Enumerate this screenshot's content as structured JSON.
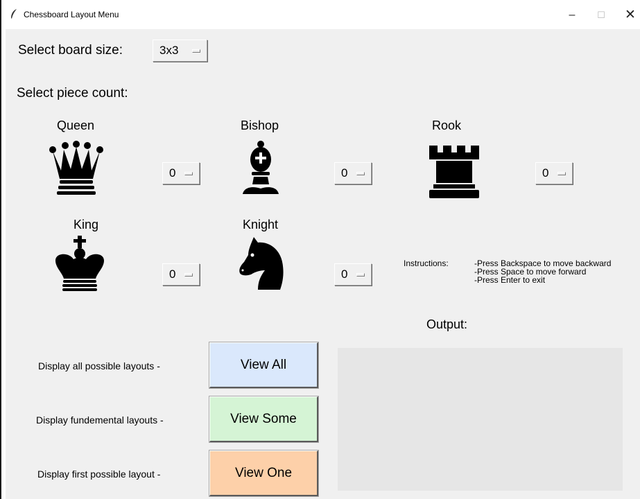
{
  "window": {
    "title": "Chessboard Layout Menu",
    "minimize_glyph": "–",
    "maximize_glyph": "☐",
    "close_glyph": "✕"
  },
  "board_size": {
    "label": "Select board size:",
    "value": "3x3"
  },
  "piece_count_label": "Select piece count:",
  "pieces": [
    {
      "name": "Queen",
      "icon": "queen-icon",
      "count": "0"
    },
    {
      "name": "Bishop",
      "icon": "bishop-icon",
      "count": "0"
    },
    {
      "name": "Rook",
      "icon": "rook-icon",
      "count": "0"
    },
    {
      "name": "King",
      "icon": "king-icon",
      "count": "0"
    },
    {
      "name": "Knight",
      "icon": "knight-icon",
      "count": "0"
    }
  ],
  "instructions": {
    "label": "Instructions:",
    "lines": [
      "-Press Backspace to move backward",
      "-Press Space to move forward",
      "-Press Enter to exit"
    ]
  },
  "output": {
    "label": "Output:"
  },
  "actions": [
    {
      "description": "Display all possible layouts -",
      "button": "View All",
      "color": "#dae8fc"
    },
    {
      "description": "Display fundemental layouts -",
      "button": "View Some",
      "color": "#d5f4d5"
    },
    {
      "description": "Display first possible layout -",
      "button": "View One",
      "color": "#fdd0a9"
    }
  ]
}
